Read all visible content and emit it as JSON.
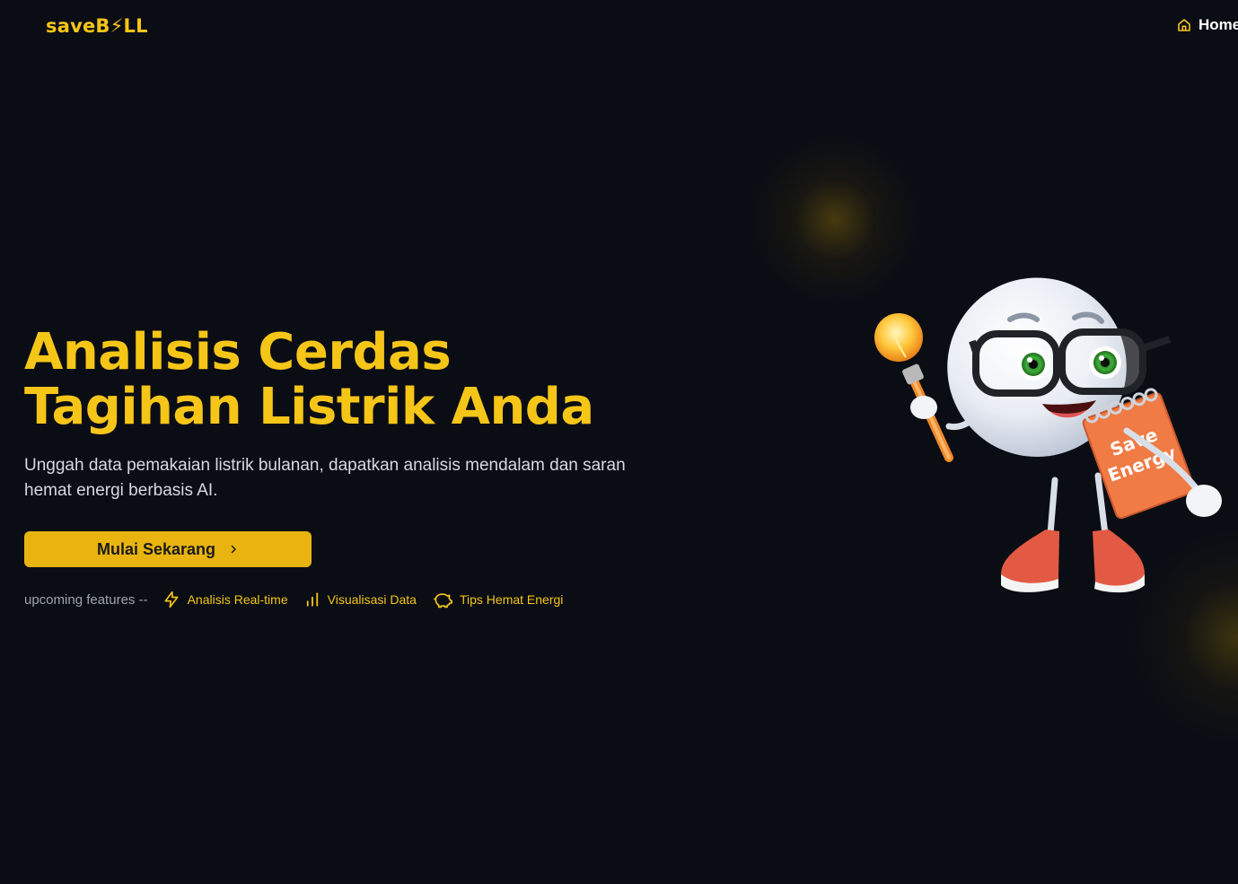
{
  "header": {
    "logo": "saveB⚡LL",
    "nav": {
      "home_label": "Home"
    }
  },
  "hero": {
    "title_line1": "Analisis Cerdas",
    "title_line2": "Tagihan Listrik Anda",
    "subtitle": "Unggah data pemakaian listrik bulanan, dapatkan analisis mendalam dan saran hemat energi berbasis AI.",
    "cta_label": "Mulai Sekarang"
  },
  "features": {
    "label": "upcoming features --",
    "items": [
      {
        "label": "Analisis Real-time",
        "icon": "lightning-icon"
      },
      {
        "label": "Visualisasi Data",
        "icon": "bar-chart-icon"
      },
      {
        "label": "Tips Hemat Energi",
        "icon": "piggy-bank-icon"
      }
    ]
  },
  "mascot": {
    "notebook_text_line1": "Save",
    "notebook_text_line2": "Energy"
  },
  "colors": {
    "accent": "#f5c518",
    "button": "#e9b40f",
    "background": "#0b0d14"
  }
}
